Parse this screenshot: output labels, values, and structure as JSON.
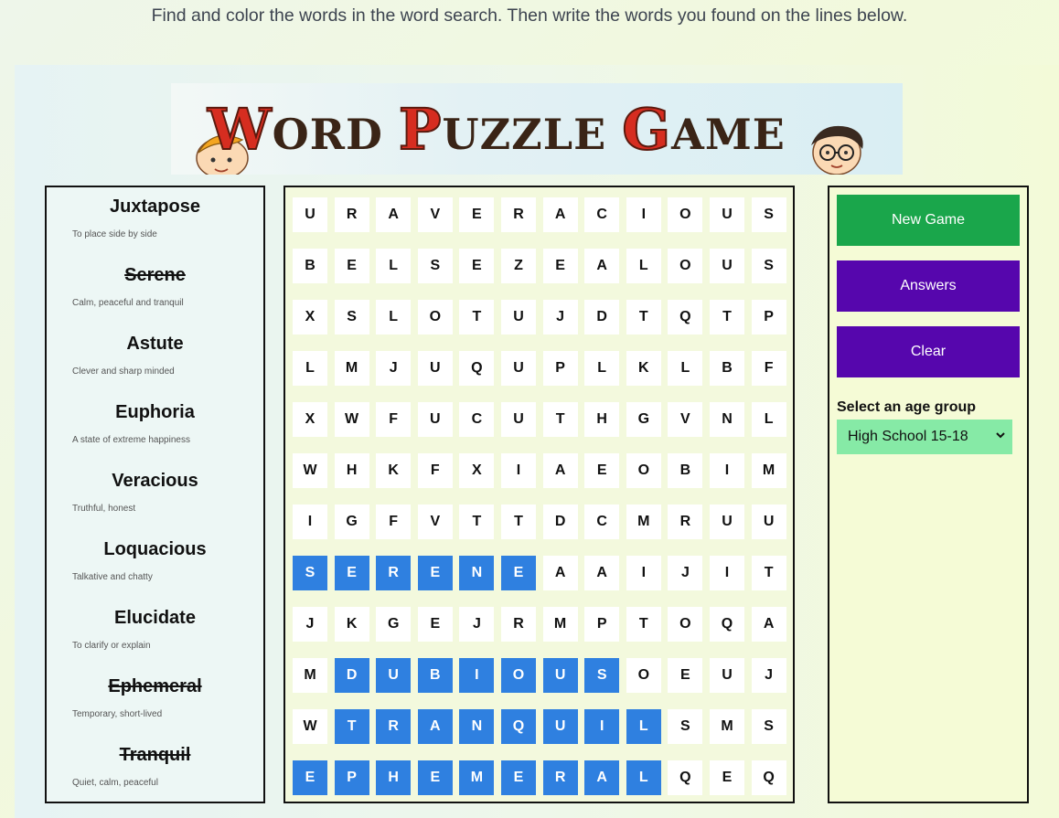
{
  "instruction": "Find and color the words in the word search. Then write the words you found on the lines below.",
  "banner": {
    "text_first": "W",
    "text_rest1": "ORD ",
    "text_first2": "P",
    "text_rest2": "UZZLE ",
    "text_first3": "G",
    "text_rest3": "AME"
  },
  "words": [
    {
      "word": "Juxtapose",
      "definition": "To place side by side",
      "found": false
    },
    {
      "word": "Serene",
      "definition": "Calm, peaceful and tranquil",
      "found": true
    },
    {
      "word": "Astute",
      "definition": "Clever and sharp minded",
      "found": false
    },
    {
      "word": "Euphoria",
      "definition": "A state of extreme happiness",
      "found": false
    },
    {
      "word": "Veracious",
      "definition": "Truthful, honest",
      "found": false
    },
    {
      "word": "Loquacious",
      "definition": "Talkative and chatty",
      "found": false
    },
    {
      "word": "Elucidate",
      "definition": "To clarify or explain",
      "found": false
    },
    {
      "word": "Ephemeral",
      "definition": "Temporary, short-lived",
      "found": true
    },
    {
      "word": "Tranquil",
      "definition": "Quiet, calm, peaceful",
      "found": true
    }
  ],
  "grid": [
    "URAVERACIOUS",
    "BELSEZEALOUS",
    "XSLOTUJDTQTP",
    "LMJUQUPLKLBF",
    "XWFUCUTHGVNL",
    "WHKFXIAEOBIM",
    "IGFVTTDCMRUU",
    "SERENEAAIJIT",
    "JKGEJRMPTOQA",
    "MDUBIOUSOEUJ",
    "WTRANQUILSMS",
    "EPHEMERALQEQ"
  ],
  "highlighted": [
    [
      7,
      0,
      5
    ],
    [
      9,
      1,
      7
    ],
    [
      10,
      1,
      8
    ],
    [
      11,
      0,
      8
    ]
  ],
  "colors": {
    "highlight": "#2f80e0",
    "new_game": "#1aa64b",
    "purple": "#5606ad",
    "select_bg": "#86eaa6"
  },
  "buttons": {
    "new_game": "New Game",
    "answers": "Answers",
    "clear": "Clear"
  },
  "age_group": {
    "label": "Select an age group",
    "selected": "High School 15-18"
  }
}
